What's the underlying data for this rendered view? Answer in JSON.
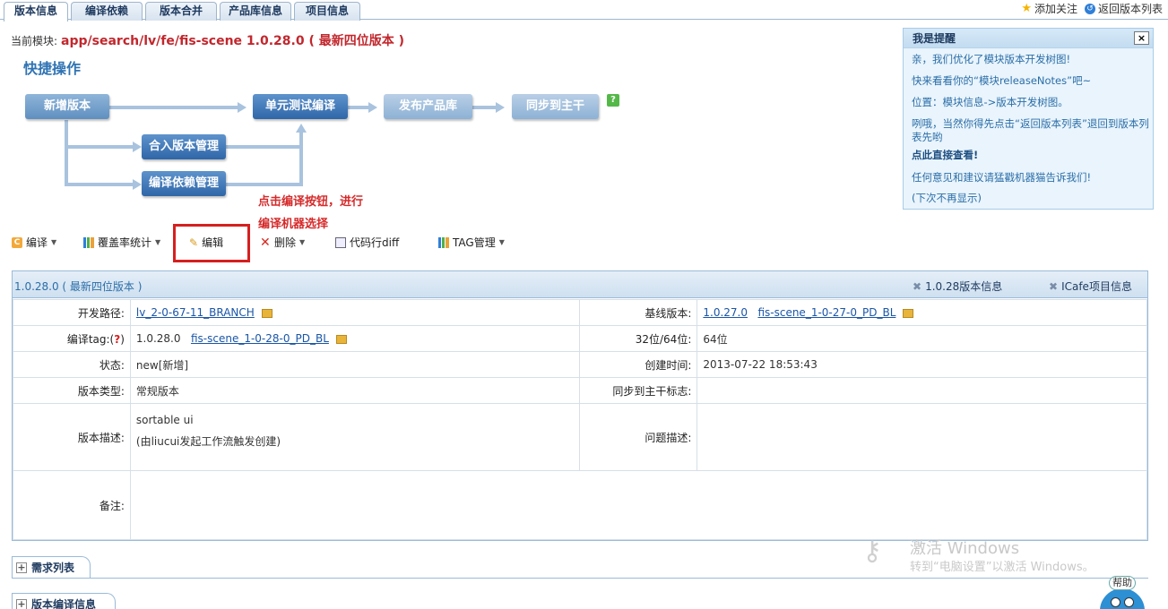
{
  "tabs": [
    "版本信息",
    "编译依赖",
    "版本合并",
    "产品库信息",
    "项目信息"
  ],
  "top_actions": {
    "follow": "添加关注",
    "back": "返回版本列表"
  },
  "module": {
    "label": "当前模块:",
    "value": "app/search/lv/fe/fis-scene 1.0.28.0 ( 最新四位版本 )"
  },
  "quick": {
    "title": "快捷操作",
    "buttons": {
      "new_version": "新增版本",
      "unit_test": "单元测试编译",
      "publish": "发布产品库",
      "sync": "同步到主干",
      "merge": "合入版本管理",
      "deps": "编译依赖管理"
    },
    "help_glyph": "?"
  },
  "annotation": {
    "line1": "点击编译按钮，进行",
    "line2": "编译机器选择"
  },
  "toolbar": {
    "compile": "编译",
    "coverage": "覆盖率统计",
    "edit": "编辑",
    "delete": "删除",
    "diff": "代码行diff",
    "tag": "TAG管理"
  },
  "reminder": {
    "title": "我是提醒",
    "close": "×",
    "lines": [
      "亲，我们优化了模块版本开发树图!",
      "快来看看你的“模块releaseNotes”吧~",
      "位置：模块信息->版本开发树图。",
      "咧哦，当然你得先点击“返回版本列表”退回到版本列表先哟",
      "点此直接查看!",
      "任何意见和建议请猛戳机器猫告诉我们!",
      "(下次不再显示)"
    ]
  },
  "panel": {
    "title": "1.0.28.0 ( 最新四位版本 )",
    "links": {
      "version_info": "1.0.28版本信息",
      "icafe": "ICafe项目信息"
    },
    "rows": {
      "dev_path": {
        "label": "开发路径:",
        "value": "lv_2-0-67-11_BRANCH"
      },
      "baseline": {
        "label": "基线版本:",
        "v1": "1.0.27.0",
        "v2": "fis-scene_1-0-27-0_PD_BL"
      },
      "tag": {
        "label_pre": "编译tag:(",
        "q": "?",
        "label_post": ")",
        "v1": "1.0.28.0",
        "v2": "fis-scene_1-0-28-0_PD_BL"
      },
      "bits": {
        "label": "32位/64位:",
        "value": "64位"
      },
      "state": {
        "label": "状态:",
        "value": "new[新增]"
      },
      "created": {
        "label": "创建时间:",
        "value": "2013-07-22 18:53:43"
      },
      "vtype": {
        "label": "版本类型:",
        "value": "常规版本"
      },
      "sync_flag": {
        "label": "同步到主干标志:",
        "value": ""
      },
      "desc": {
        "label": "版本描述:",
        "line1": "sortable ui",
        "line2": "(由liucui发起工作流触发创建)"
      },
      "issue": {
        "label": "问题描述:",
        "value": ""
      },
      "remark": {
        "label": "备注:",
        "value": ""
      }
    }
  },
  "sections": {
    "requirements": "需求列表",
    "compile_info": "版本编译信息"
  },
  "watermark": {
    "line1": "激活 Windows",
    "line2": "转到“电脑设置”以激活 Windows。"
  },
  "help_badge": "帮助"
}
